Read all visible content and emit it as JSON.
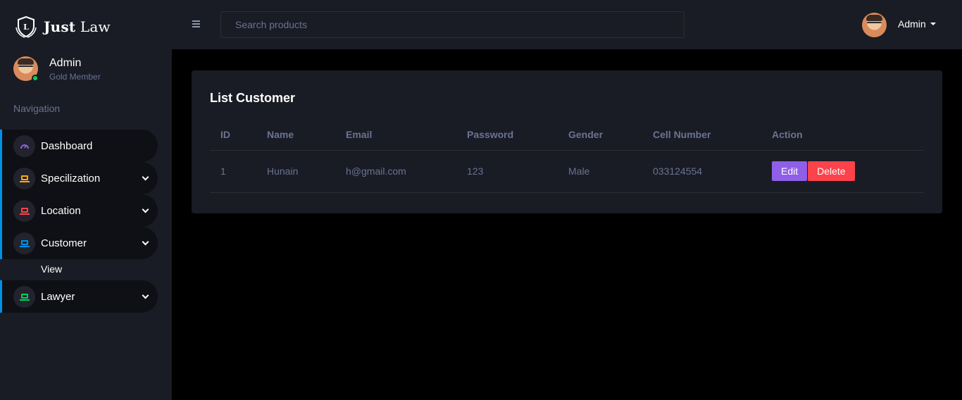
{
  "brand": {
    "bold": "Just",
    "rest": " Law"
  },
  "profile": {
    "name": "Admin",
    "subtitle": "Gold Member"
  },
  "nav": {
    "caption": "Navigation",
    "items": [
      {
        "label": "Dashboard",
        "icon": "speedometer-icon",
        "color": "#8f5fe8"
      },
      {
        "label": "Specilization",
        "icon": "laptop-icon",
        "color": "#ffab00"
      },
      {
        "label": "Location",
        "icon": "laptop-icon",
        "color": "#fc424a"
      },
      {
        "label": "Customer",
        "icon": "laptop-icon",
        "color": "#0090e7"
      },
      {
        "label": "Lawyer",
        "icon": "laptop-icon",
        "color": "#00d25b"
      }
    ],
    "sub_item": "View"
  },
  "topbar": {
    "search_placeholder": "Search products",
    "user": "Admin"
  },
  "card": {
    "title": "List Customer",
    "columns": [
      "ID",
      "Name",
      "Email",
      "Password",
      "Gender",
      "Cell Number",
      "Action"
    ],
    "rows": [
      {
        "id": "1",
        "name": "Hunain",
        "email": "h@gmail.com",
        "password": "123",
        "gender": "Male",
        "cell": "033124554"
      }
    ],
    "edit_label": "Edit",
    "delete_label": "Delete"
  },
  "colors": {
    "accent_blue": "#0090e7",
    "sidebar_bg": "#191c24",
    "muted": "#6c7293",
    "edit": "#8f5fe8",
    "delete": "#fc424a"
  }
}
